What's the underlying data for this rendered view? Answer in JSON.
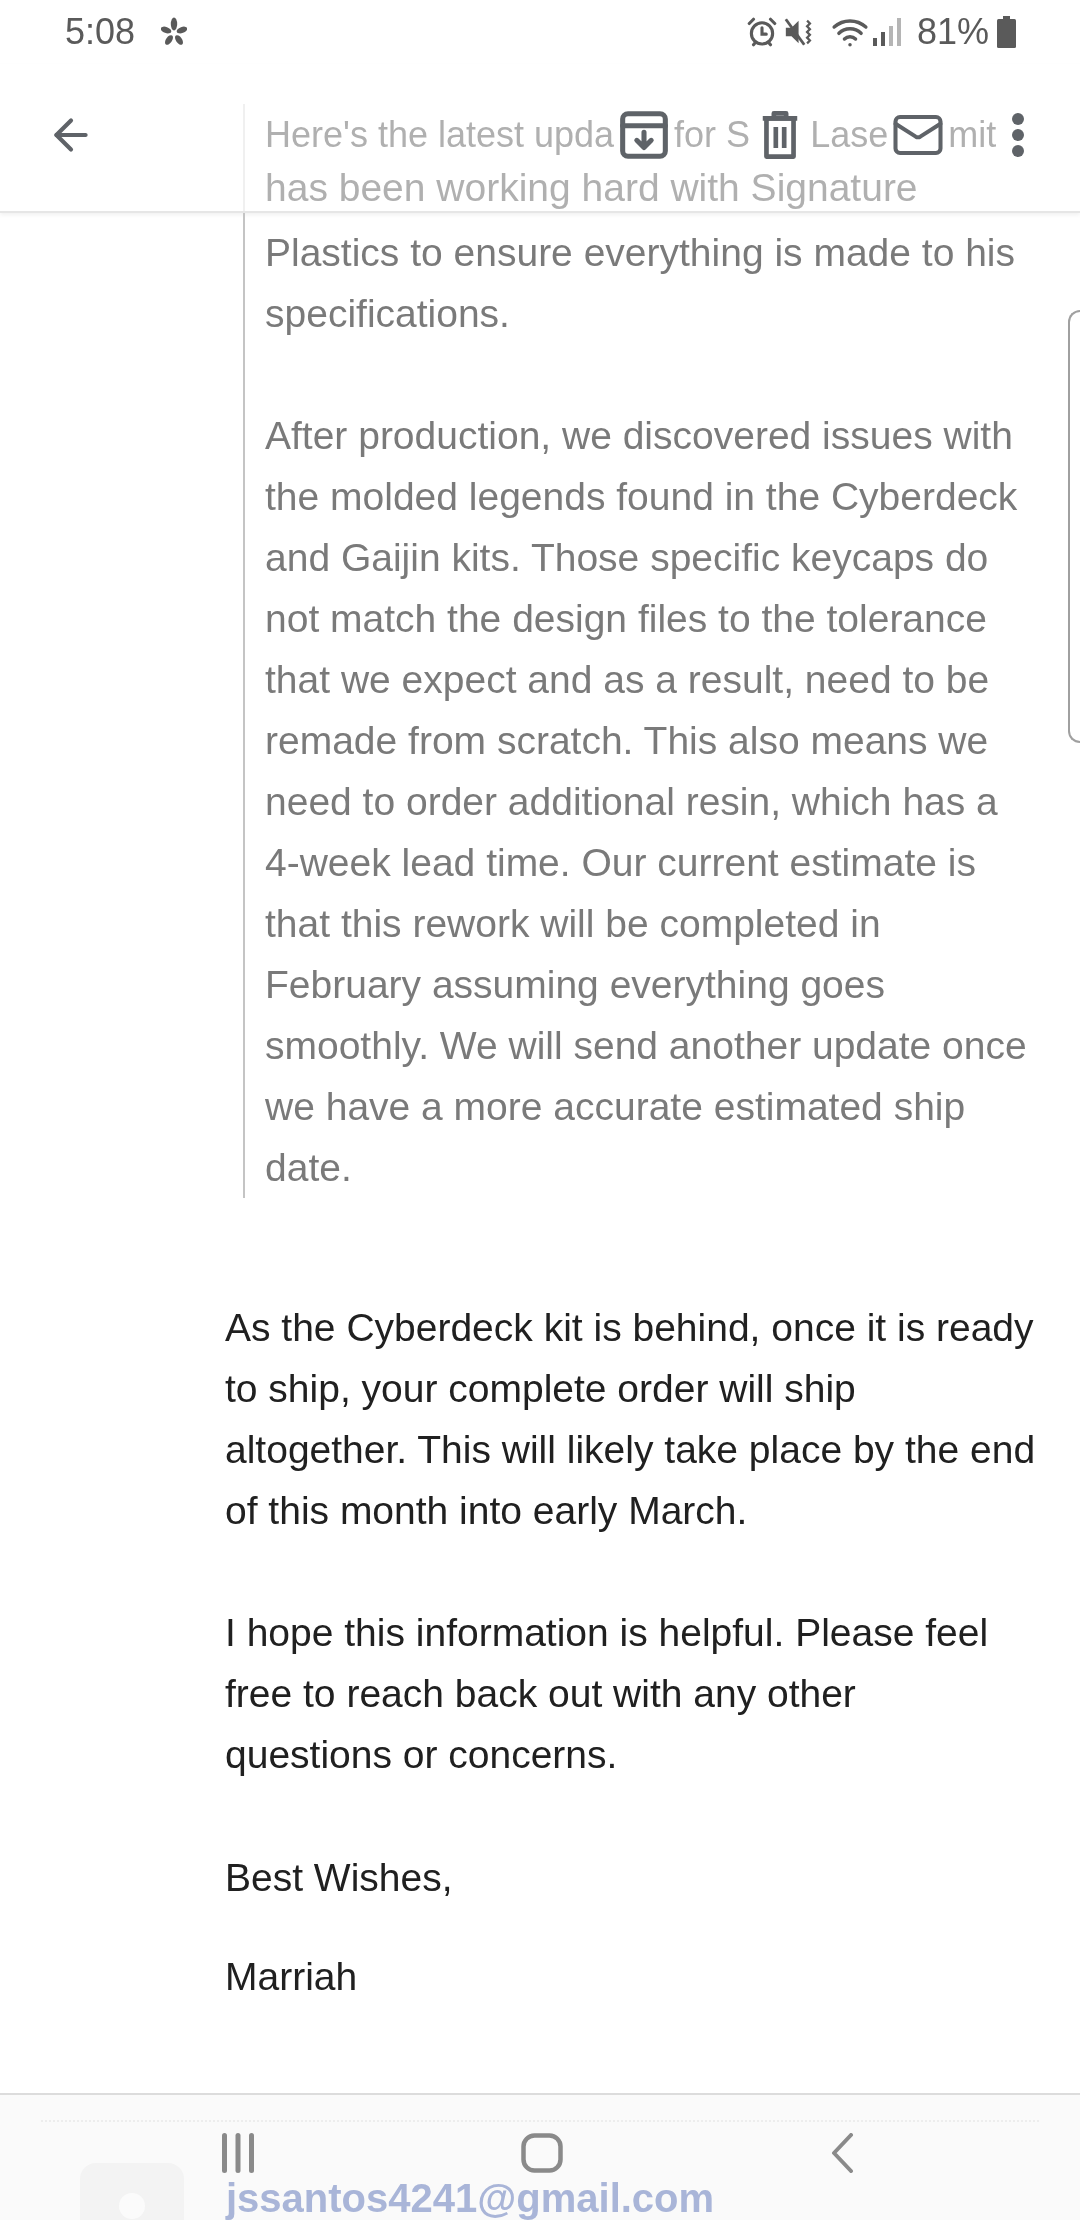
{
  "status_bar": {
    "time": "5:08",
    "battery": "81%"
  },
  "quote": {
    "covered_first_line": [
      "Here's the latest upda",
      "for S",
      "Lase",
      "mit"
    ],
    "faded_second_line": "has been working hard with Signature",
    "paragraphs": [
      "Plastics to ensure everything is made to his specifications.",
      "After production, we discovered issues with the molded legends found in the Cyberdeck and Gaijin kits. Those specific keycaps do not match the design files to the tolerance that we expect and as a result, need to be remade from scratch. This also means we need to order additional resin, which has a 4-week lead time. Our current estimate is that this rework will be completed in February assuming everything goes smoothly. We will send another update once we have a more accurate estimated ship date."
    ]
  },
  "body": {
    "paragraphs": [
      "As the Cyberdeck kit is behind, once it is ready to ship, your complete order will ship altogether. This will likely take place by the end of this month into early March.",
      "I hope this information is helpful. Please feel free to reach back out with any other questions or concerns."
    ],
    "closing": "Best Wishes,",
    "signature": "Marriah"
  },
  "nav_bar": {
    "underlying_email": "jssantos4241@gmail.com"
  }
}
